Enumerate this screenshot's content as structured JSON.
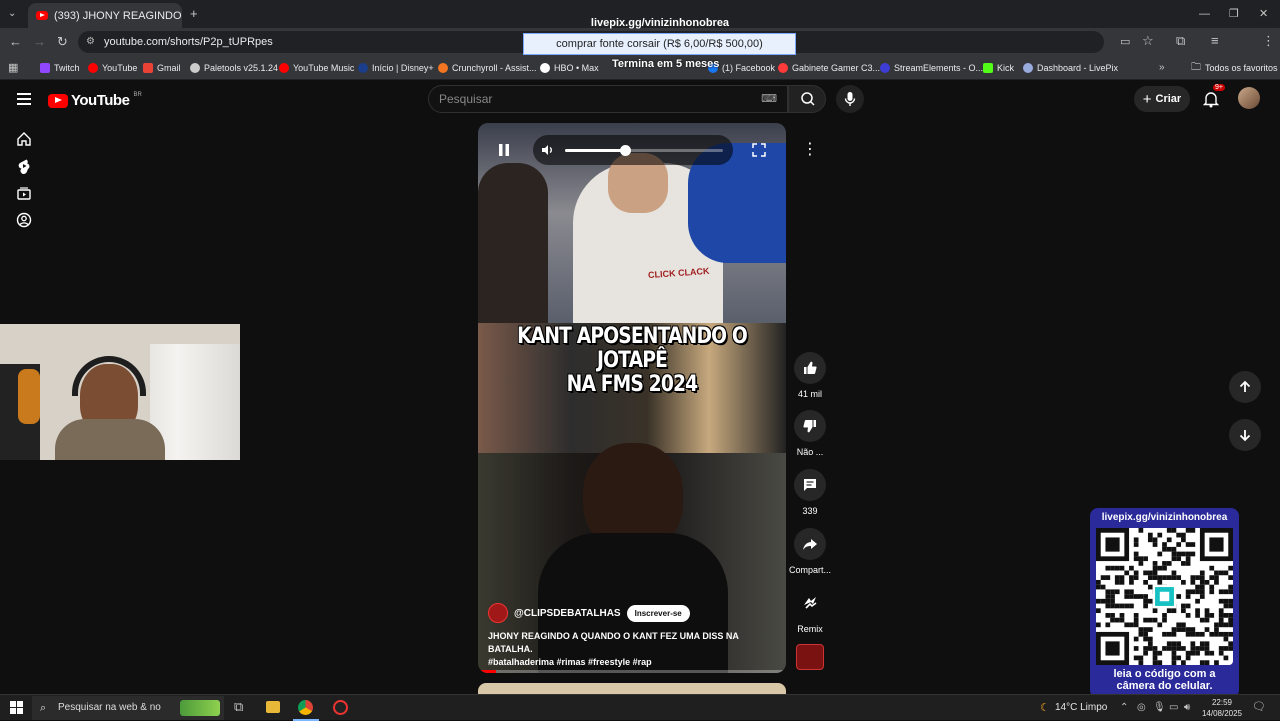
{
  "browser": {
    "tab": {
      "title": "(393) JHONY REAGINDO A"
    },
    "url": "youtube.com/shorts/P2p_tUPRpes",
    "bookmarks": [
      {
        "label": "Twitch",
        "color": "#9146ff"
      },
      {
        "label": "YouTube",
        "color": "#ff0000"
      },
      {
        "label": "Gmail",
        "color": "#ea4335"
      },
      {
        "label": "Paletools v25.1.24",
        "color": "#cccccc"
      },
      {
        "label": "YouTube Music",
        "color": "#ff0000"
      },
      {
        "label": "Início | Disney+",
        "color": "#1a3e8c"
      },
      {
        "label": "Crunchyroll - Assist...",
        "color": "#f47521"
      },
      {
        "label": "HBO • Max",
        "color": "#ffffff"
      },
      {
        "label": "(1) Facebook",
        "color": "#1877f2"
      },
      {
        "label": "Gabinete Gamer C3...",
        "color": "#ff3a3a"
      },
      {
        "label": "StreamElements - O...",
        "color": "#3d3dd6"
      },
      {
        "label": "Kick",
        "color": "#53fc18"
      },
      {
        "label": "Dashboard - LivePix",
        "color": "#9ad"
      }
    ],
    "all_favorites": "Todos os favoritos"
  },
  "stream_overlay": {
    "url": "livepix.gg/vinizinhonobrea",
    "donation_goal": "comprar fonte corsair (R$ 6,00/R$ 500,00)",
    "subscription_text": "Termina em 5 meses"
  },
  "youtube": {
    "logo": {
      "word": "YouTube",
      "region": "BR"
    },
    "search_placeholder": "Pesquisar",
    "create_label": "Criar",
    "notifications_badge": "9+"
  },
  "video": {
    "headline_line1": "KANT APOSENTANDO O JOTAPÊ",
    "headline_line2": "NA FMS 2024",
    "shirt_text": "CLICK CLACK",
    "volume_percent": 38,
    "progress_percent": 6,
    "channel": "@CLIPSDEBATALHAS",
    "subscribe_label": "Inscrever-se",
    "title": "JHONY REAGINDO A QUANDO O KANT FEZ UMA DISS NA BATALHA.",
    "hashtags": "#batalhaderima #rimas #freestyle #rap"
  },
  "actions": {
    "likes": "41 mil",
    "dislike": "Não ...",
    "comments": "339",
    "share": "Compart...",
    "remix": "Remix"
  },
  "qr_panel": {
    "url": "livepix.gg/vinizinhonobrea",
    "footer_line1": "leia o código com a",
    "footer_line2": "câmera do celular."
  },
  "taskbar": {
    "search_placeholder": "Pesquisar na web & no",
    "weather": "14°C  Limpo",
    "time": "22:59",
    "date": "14/08/2025"
  }
}
